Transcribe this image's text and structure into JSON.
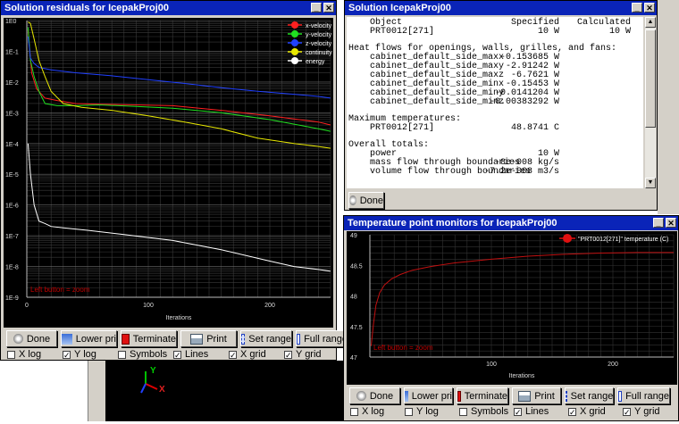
{
  "residuals_window": {
    "title": "Solution residuals for IcepakProj00",
    "zoom_hint": "Left button = zoom",
    "buttons": {
      "done": "Done",
      "lower_pri": "Lower pri",
      "terminate": "Terminate",
      "print": "Print",
      "set_range": "Set range",
      "full_range": "Full range"
    },
    "checkboxes": [
      {
        "label": "X log",
        "checked": false
      },
      {
        "label": "Y log",
        "checked": true
      },
      {
        "label": "Symbols",
        "checked": false
      },
      {
        "label": "Lines",
        "checked": true
      },
      {
        "label": "X grid",
        "checked": true
      },
      {
        "label": "Y grid",
        "checked": true
      }
    ]
  },
  "solution_window": {
    "title": "Solution IcepakProj00",
    "header": {
      "object": "Object",
      "specified": "Specified",
      "calculated": "Calculated"
    },
    "first_row": {
      "object": "PRT0012[271]",
      "specified": "10 W",
      "calculated": "10 W"
    },
    "heat_flows_title": "Heat flows for openings, walls, grilles, and fans:",
    "heat_flows": [
      {
        "name": "cabinet_default_side_maxx",
        "value": "-0.153685 W"
      },
      {
        "name": "cabinet_default_side_maxy",
        "value": "-2.91242 W"
      },
      {
        "name": "cabinet_default_side_maxz",
        "value": "-6.7621 W"
      },
      {
        "name": "cabinet_default_side_minx",
        "value": "-0.15453 W"
      },
      {
        "name": "cabinet_default_side_miny",
        "value": "-0.0141204 W"
      },
      {
        "name": "cabinet_default_side_minz",
        "value": "-0.00383292 W"
      }
    ],
    "max_temp_title": "Maximum temperatures:",
    "max_temp": {
      "name": "PRT0012[271]",
      "value": "48.8741 C"
    },
    "totals_title": "Overall totals:",
    "totals": [
      {
        "name": "power",
        "value": "10 W"
      },
      {
        "name": "mass flow through boundaries",
        "value": "-8e-008 kg/s"
      },
      {
        "name": "volume flow through boundaries",
        "value": "-7.2e-008 m3/s"
      }
    ],
    "done_label": "Done"
  },
  "temp_window": {
    "title": "Temperature point monitors for IcepakProj00",
    "zoom_hint": "Left button = zoom",
    "buttons": {
      "done": "Done",
      "lower_pri": "Lower pri",
      "terminate": "Terminate",
      "print": "Print",
      "set_range": "Set range",
      "full_range": "Full range"
    },
    "checkboxes": [
      {
        "label": "X log",
        "checked": false
      },
      {
        "label": "Y log",
        "checked": false
      },
      {
        "label": "Symbols",
        "checked": false
      },
      {
        "label": "Lines",
        "checked": true
      },
      {
        "label": "X grid",
        "checked": true
      },
      {
        "label": "Y grid",
        "checked": true
      }
    ]
  },
  "axes_triad": {
    "y": "Y",
    "x": "X"
  },
  "chart_data": [
    {
      "type": "line",
      "xlabel": "Iterations",
      "ylabel": "",
      "x_ticks": [
        0,
        100,
        200
      ],
      "xlim": [
        0,
        250
      ],
      "y_log": true,
      "ylim": [
        1e-09,
        1
      ],
      "y_ticks": [
        "1E0",
        "1E-1",
        "1E-2",
        "1E-3",
        "1E-4",
        "1E-5",
        "1E-6",
        "1E-7",
        "1E-8",
        "1E-9"
      ],
      "legend_position": "top-right",
      "series": [
        {
          "name": "x-velocity",
          "color": "#ff2020",
          "x": [
            1,
            4,
            8,
            15,
            25,
            40,
            60,
            90,
            120,
            160,
            200,
            240,
            250
          ],
          "y": [
            0.5,
            0.02,
            0.006,
            0.003,
            0.0025,
            0.002,
            0.0019,
            0.0018,
            0.0017,
            0.0012,
            0.0008,
            0.0005,
            0.0004
          ]
        },
        {
          "name": "y-velocity",
          "color": "#20e020",
          "x": [
            1,
            3,
            6,
            10,
            15,
            25,
            40,
            60,
            90,
            120,
            160,
            200,
            240,
            250
          ],
          "y": [
            0.6,
            0.05,
            0.015,
            0.005,
            0.002,
            0.0017,
            0.0017,
            0.0018,
            0.0016,
            0.0014,
            0.001,
            0.0006,
            0.0003,
            0.00025
          ]
        },
        {
          "name": "z-velocity",
          "color": "#2040ff",
          "x": [
            1,
            3,
            6,
            10,
            20,
            40,
            70,
            100,
            130,
            160,
            190,
            220,
            240,
            250
          ],
          "y": [
            0.3,
            0.06,
            0.04,
            0.03,
            0.025,
            0.02,
            0.016,
            0.012,
            0.009,
            0.0065,
            0.005,
            0.004,
            0.0034,
            0.003
          ]
        },
        {
          "name": "continuity",
          "color": "#e8e800",
          "x": [
            1,
            3,
            6,
            10,
            15,
            20,
            30,
            45,
            70,
            100,
            130,
            160,
            190,
            220,
            240,
            250
          ],
          "y": [
            0.9,
            0.8,
            0.25,
            0.05,
            0.015,
            0.005,
            0.002,
            0.0015,
            0.0012,
            0.0008,
            0.0005,
            0.0003,
            0.00015,
            0.0001,
            8e-05,
            7e-05
          ]
        },
        {
          "name": "energy",
          "color": "#ffffff",
          "x": [
            1,
            3,
            6,
            10,
            15,
            20,
            30,
            50,
            80,
            120,
            160,
            200,
            220,
            240,
            250
          ],
          "y": [
            0.0001,
            1e-05,
            1e-06,
            3e-07,
            2.5e-07,
            2e-07,
            1.8e-07,
            1.5e-07,
            1.1e-07,
            7e-08,
            3.5e-08,
            1.5e-08,
            1e-08,
            8e-09,
            7e-09
          ]
        }
      ]
    },
    {
      "type": "line",
      "xlabel": "Iterations",
      "ylabel": "",
      "x_ticks": [
        100,
        200
      ],
      "xlim": [
        0,
        250
      ],
      "y_ticks": [
        47,
        47.5,
        48,
        48.5,
        49
      ],
      "ylim": [
        47,
        49
      ],
      "legend_position": "top-right",
      "series": [
        {
          "name": "\"PRT0012[271]\" temperature (C)",
          "color": "#c01010",
          "x": [
            1,
            3,
            5,
            8,
            12,
            18,
            25,
            35,
            50,
            70,
            100,
            130,
            160,
            190,
            220,
            250
          ],
          "y": [
            47.18,
            47.55,
            47.85,
            48.05,
            48.18,
            48.28,
            48.35,
            48.42,
            48.48,
            48.54,
            48.6,
            48.65,
            48.68,
            48.7,
            48.71,
            48.71
          ]
        }
      ]
    }
  ]
}
